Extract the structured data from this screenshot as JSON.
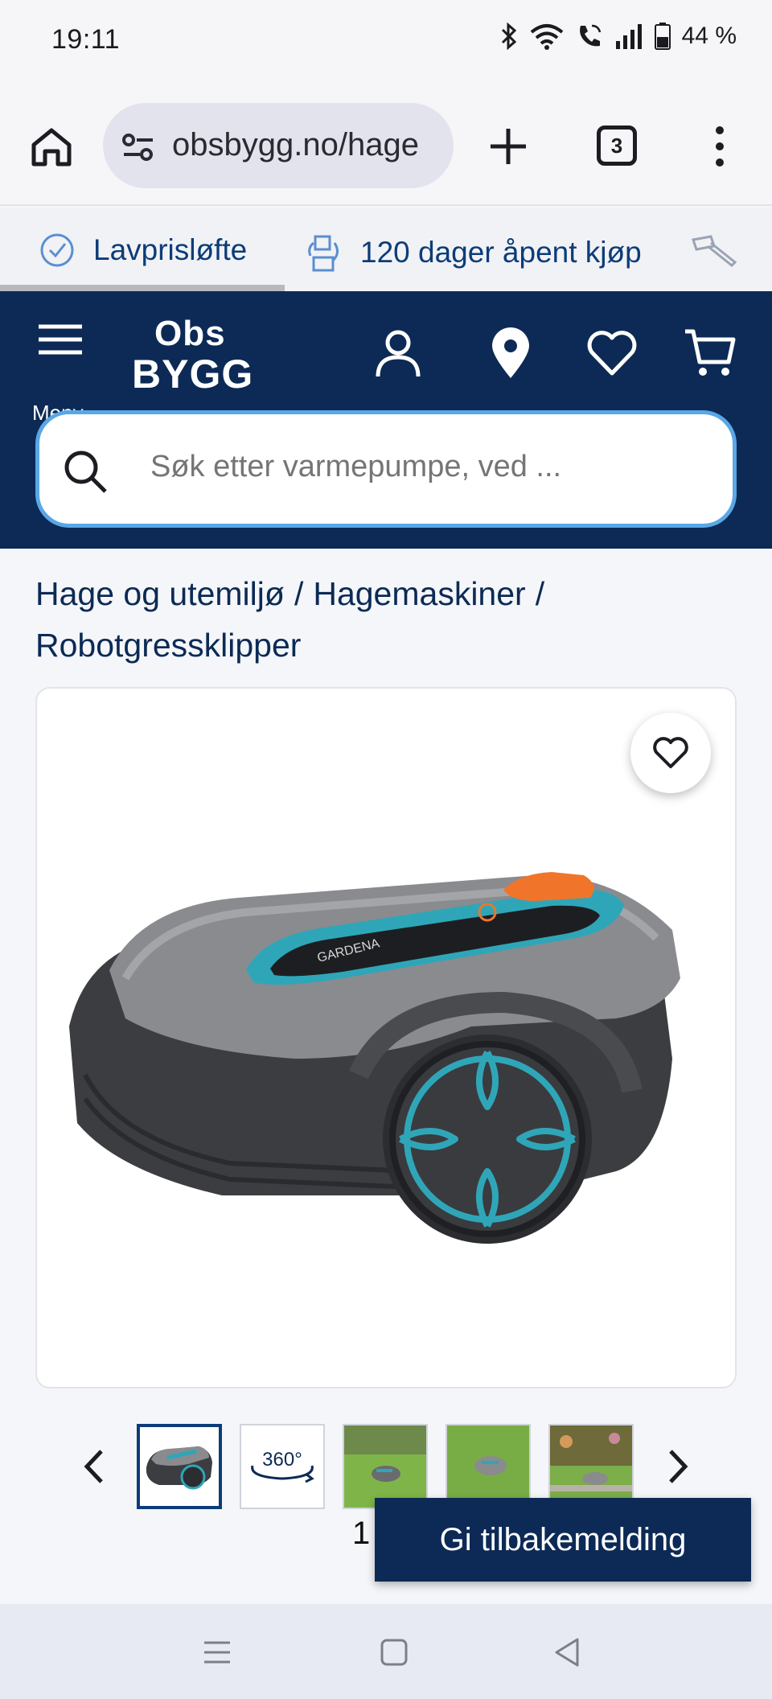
{
  "status_bar": {
    "time": "19:11",
    "battery": "44 %",
    "icons": [
      "bluetooth-icon",
      "wifi-icon",
      "wifi-call-icon",
      "signal-icon",
      "battery-icon"
    ]
  },
  "browser": {
    "url": "obsbygg.no/hage",
    "tab_count": "3"
  },
  "usp": {
    "items": [
      {
        "label": "Lavprisløfte",
        "icon": "check-circle-icon"
      },
      {
        "label": "120 dager åpent kjøp",
        "icon": "return-box-icon"
      },
      {
        "label": "",
        "icon": "hammer-icon"
      }
    ]
  },
  "header": {
    "menu_label": "Meny",
    "logo_top": "Obs",
    "logo_bottom": "BYGG",
    "search_placeholder": "Søk etter varmepumpe, ved ..."
  },
  "breadcrumb": {
    "items": [
      "Hage og utemiljø",
      "Hagemaskiner",
      "Robotgressklipper"
    ]
  },
  "product": {
    "image_brand_text": "GARDENA"
  },
  "gallery": {
    "thumb_360_label": "360°",
    "counter": "1"
  },
  "feedback": {
    "label": "Gi tilbakemelding"
  },
  "colors": {
    "brand_navy": "#0c2a55",
    "search_border": "#5aa7e6",
    "accent_teal": "#2fa6b8",
    "accent_orange": "#f0752a"
  }
}
